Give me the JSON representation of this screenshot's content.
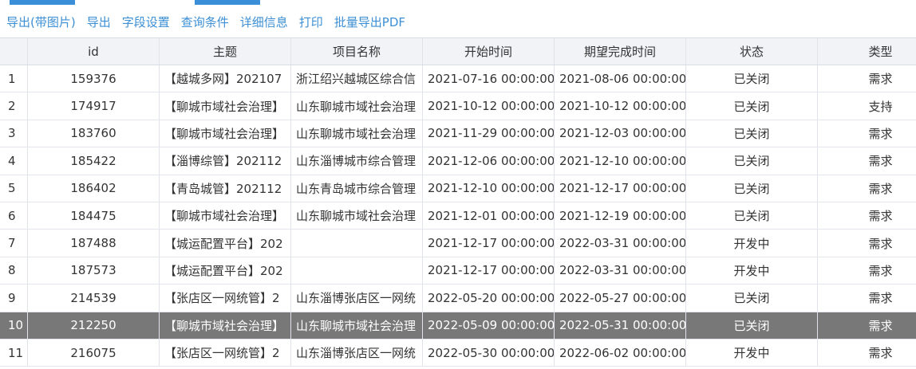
{
  "toolbar": {
    "items": [
      "导出(带图片)",
      "导出",
      "字段设置",
      "查询条件",
      "详细信息",
      "打印",
      "批量导出PDF"
    ]
  },
  "table": {
    "columns": {
      "index": "",
      "id": "id",
      "topic": "主题",
      "project": "项目名称",
      "start": "开始时间",
      "due": "期望完成时间",
      "status": "状态",
      "type": "类型"
    },
    "rows": [
      {
        "index": "1",
        "id": "159376",
        "topic": "【越城多网】202107",
        "project": "浙江绍兴越城区综合信",
        "start": "2021-07-16 00:00:00",
        "due": "2021-08-06 00:00:00",
        "status": "已关闭",
        "type": "需求"
      },
      {
        "index": "2",
        "id": "174917",
        "topic": "【聊城市域社会治理】",
        "project": "山东聊城市域社会治理",
        "start": "2021-10-12 00:00:00",
        "due": "2021-10-12 00:00:00",
        "status": "已关闭",
        "type": "支持"
      },
      {
        "index": "3",
        "id": "183760",
        "topic": "【聊城市域社会治理】",
        "project": "山东聊城市域社会治理",
        "start": "2021-11-29 00:00:00",
        "due": "2021-12-03 00:00:00",
        "status": "已关闭",
        "type": "需求"
      },
      {
        "index": "4",
        "id": "185422",
        "topic": "【淄博综管】202112",
        "project": "山东淄博城市综合管理",
        "start": "2021-12-06 00:00:00",
        "due": "2021-12-10 00:00:00",
        "status": "已关闭",
        "type": "需求"
      },
      {
        "index": "5",
        "id": "186402",
        "topic": "【青岛城管】202112",
        "project": "山东青岛城市综合管理",
        "start": "2021-12-10 00:00:00",
        "due": "2021-12-17 00:00:00",
        "status": "已关闭",
        "type": "需求"
      },
      {
        "index": "6",
        "id": "184475",
        "topic": "【聊城市域社会治理】",
        "project": "山东聊城市域社会治理",
        "start": "2021-12-01 00:00:00",
        "due": "2021-12-19 00:00:00",
        "status": "已关闭",
        "type": "需求"
      },
      {
        "index": "7",
        "id": "187488",
        "topic": "【城运配置平台】202",
        "project": "",
        "start": "2021-12-17 00:00:00",
        "due": "2022-03-31 00:00:00",
        "status": "开发中",
        "type": "需求"
      },
      {
        "index": "8",
        "id": "187573",
        "topic": "【城运配置平台】202",
        "project": "",
        "start": "2021-12-17 00:00:00",
        "due": "2022-03-31 00:00:00",
        "status": "开发中",
        "type": "需求"
      },
      {
        "index": "9",
        "id": "214539",
        "topic": "【张店区一网统管】2",
        "project": "山东淄博张店区一网统",
        "start": "2022-05-20 00:00:00",
        "due": "2022-05-27 00:00:00",
        "status": "已关闭",
        "type": "需求"
      },
      {
        "index": "10",
        "id": "212250",
        "topic": "【聊城市域社会治理】",
        "project": "山东聊城市域社会治理",
        "start": "2022-05-09 00:00:00",
        "due": "2022-05-31 00:00:00",
        "status": "已关闭",
        "type": "需求"
      },
      {
        "index": "11",
        "id": "216075",
        "topic": "【张店区一网统管】2",
        "project": "山东淄博张店区一网统",
        "start": "2022-05-30 00:00:00",
        "due": "2022-06-02 00:00:00",
        "status": "开发中",
        "type": "需求"
      }
    ],
    "selected_index": "10"
  },
  "colors": {
    "link": "#3c8fd4",
    "selected_row": "#787878",
    "header_bg": "#f2f3f7",
    "tab_accent": "#3b8fd9"
  }
}
